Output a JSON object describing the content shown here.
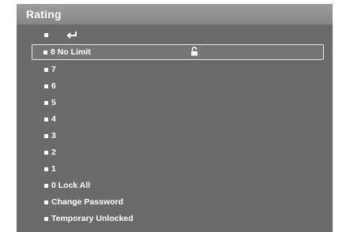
{
  "title": "Rating",
  "items": [
    {
      "label": "",
      "icon": "return-icon"
    },
    {
      "label": "8 No Limit",
      "icon": "lock-icon",
      "selected": true
    },
    {
      "label": "7"
    },
    {
      "label": "6"
    },
    {
      "label": "5"
    },
    {
      "label": "4"
    },
    {
      "label": "3"
    },
    {
      "label": "2"
    },
    {
      "label": "1"
    },
    {
      "label": "0 Lock All"
    },
    {
      "label": "Change Password"
    },
    {
      "label": "Temporary Unlocked"
    }
  ]
}
